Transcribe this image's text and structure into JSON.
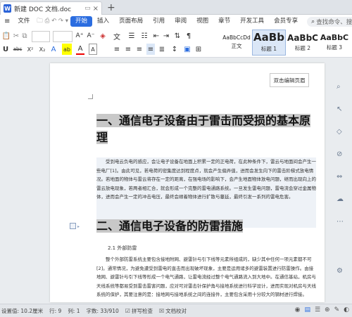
{
  "titlebar": {
    "doc_title": "新建 DOC 文档.doc",
    "new_tab": "+"
  },
  "ribbon": {
    "menu": "≡",
    "file": "文件",
    "tabs": [
      "开始",
      "插入",
      "页面布局",
      "引用",
      "审阅",
      "视图",
      "章节",
      "开发工具",
      "会员专享"
    ],
    "search_placeholder": "查找命令、搜索模板"
  },
  "styles": [
    {
      "sample": "AaBbCcDd",
      "name": "正文"
    },
    {
      "sample": "AaBb",
      "name": "标题 1"
    },
    {
      "sample": "AaBbC",
      "name": "标题 2"
    },
    {
      "sample": "AaBbC",
      "name": "标题 3"
    }
  ],
  "toolbar": {
    "paste": "粘",
    "font_size_up": "A⁺",
    "font_size_down": "A⁻",
    "bold": "B",
    "italic": "I",
    "underline": "U",
    "strike": "abc",
    "superscript": "X²",
    "subscript": "X₂",
    "clear": "A",
    "font_color": "A",
    "highlight": "ab",
    "char_border": "A"
  },
  "document": {
    "header_button": "双击编辑页眉",
    "heading1": "一、通信电子设备由于雷击而受损的基本原理",
    "heading1_line1": "一、通信电子设备由于雷击而受损的基本原",
    "heading1_line2": "理",
    "paragraph1": "受到电云负电的感应，会让电子设备在地面上积累一定的正电荷，在此种条件下，雷云与地面间会产生一些电厂[1]。由此可见，若电荷的密集度达到程度点，就会产生偏弄值，进而会发生向下的雷击阶梯式放电情况。若地面的物体与雷云将存在一定的距离，在强电场的影响下，会产生地面物体放电问题，继而出现向上的雷云放电现象，若两者相汇合，就会形成一个完整的雷电通路系统。一旦发生雷电问题，雷电流会穿过金属物体，进而会产生一定的冲击电压，最终会顺着物体进行扩散与蔓延，最终引发一系列的雷电危害。",
    "heading2": "二、通信电子设备的防雷措施",
    "subheading": "2.1 外部防雷",
    "paragraph2": "整个外部防雷系统主要包含接地附网、避雷针与引下线等元素所组成的，缺少其中任何一项元素都不可[2]。通常情况，为避免遭受到雷电的直击而出现破坏现象，主要是运用诸多的避雷装置进行防雷操作。由接地网、避雷针与引下线等形成一个电气通路，让雷电流经过整个电气通路流入到大地中。在通信基站，机房与天线系统等都易受到雷击雷害问题，应对可对雷击针保护角与接地系统进行科学设计，进而实现对机房与天线系统的保护，其要注意的是：接地网与接地系统之间的连接件，主要包含采用十分较大的钢材进行焊接。"
  },
  "status": {
    "page_setting": "设置值: 10.2厘米",
    "row": "行: 9",
    "col": "列: 1",
    "words": "字数: 33/910",
    "spell": "拼写检查",
    "proof": "文档校对"
  }
}
